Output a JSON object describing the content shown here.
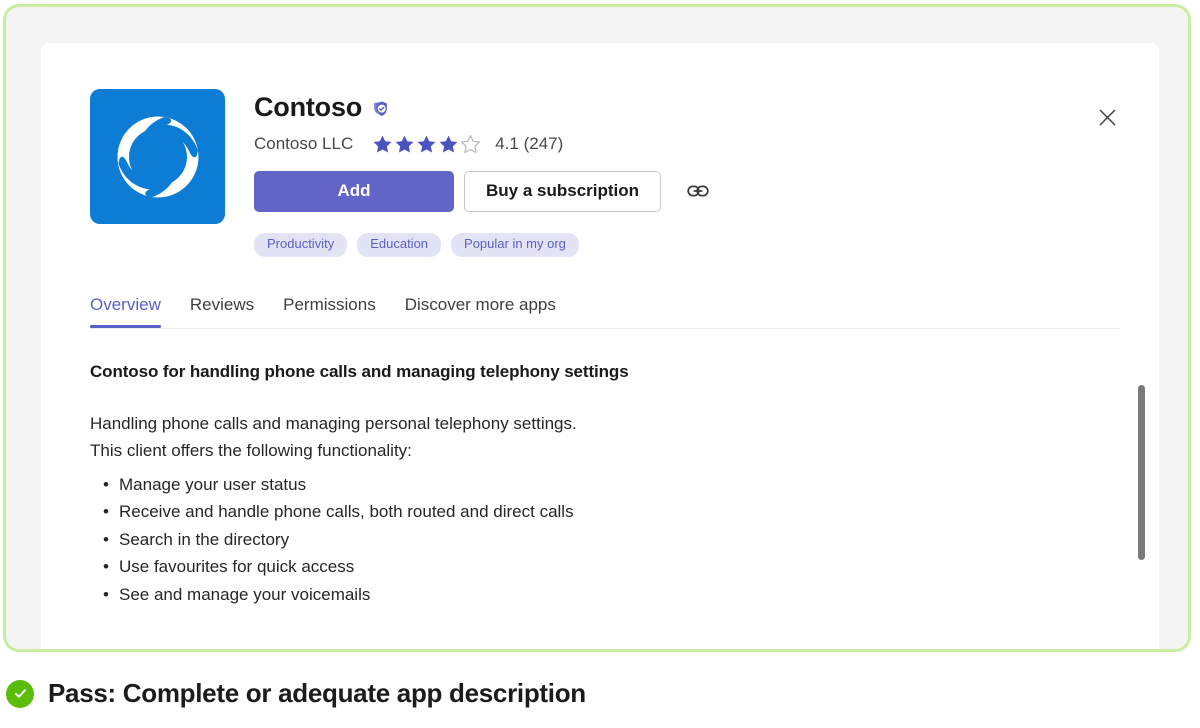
{
  "frame": {
    "border_color": "#c8efa0",
    "backdrop_color": "#f4f4f4"
  },
  "app": {
    "name": "Contoso",
    "publisher": "Contoso LLC",
    "icon_name": "contoso-swirl-icon",
    "icon_bg": "#0d7cd5",
    "verified_badge_name": "verified-publisher-shield-icon",
    "verified_badge_color": "#5b5fc7",
    "rating": {
      "stars_filled": 4,
      "stars_total": 5,
      "filled_color": "#4b53bf",
      "empty_color": "#bcbcbc",
      "value_text": "4.1 (247)"
    },
    "actions": {
      "add_label": "Add",
      "add_color": "#6264c7",
      "subscription_label": "Buy a subscription",
      "copy_link_icon": "link-icon"
    },
    "tags": [
      "Productivity",
      "Education",
      "Popular in my org"
    ],
    "tag_bg": "#e3e3f6",
    "tag_text_color": "#5b5fc7",
    "close_icon": "close-icon"
  },
  "tabs": {
    "active_color": "#5b5fc7",
    "items": [
      {
        "label": "Overview",
        "active": true
      },
      {
        "label": "Reviews",
        "active": false
      },
      {
        "label": "Permissions",
        "active": false
      },
      {
        "label": "Discover more apps",
        "active": false
      }
    ]
  },
  "overview": {
    "heading": "Contoso for handling phone calls and managing telephony settings",
    "paragraph_lines": [
      "Handling phone calls and managing personal telephony settings.",
      "This client offers the following functionality:"
    ],
    "features": [
      "Manage your user status",
      "Receive and handle phone calls, both routed and direct calls",
      "Search in the directory",
      "Use favourites for quick access",
      "See and manage your voicemails"
    ]
  },
  "scrollbar": {
    "name": "vertical-scrollbar",
    "thumb_color": "#7a7a7a"
  },
  "caption": {
    "status_icon": "check-circle-icon",
    "status_color": "#5cbc0a",
    "text": "Pass: Complete or adequate app description"
  }
}
